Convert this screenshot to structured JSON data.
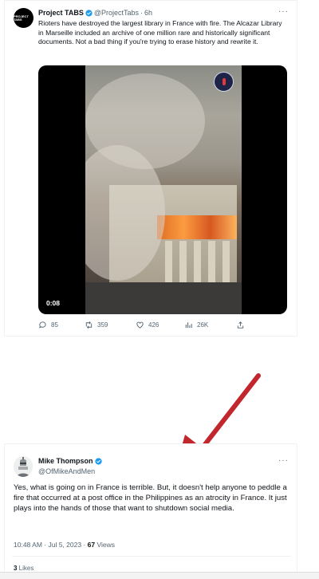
{
  "tweet1": {
    "avatar_text": "PROJECT TABS",
    "name": "Project TABS",
    "handle": "@ProjectTabs",
    "separator": "·",
    "time": "6h",
    "more": "···",
    "text": "Rioters have destroyed the largest library in France with fire. The Alcazar Library in Marseille included an archive of one million rare and historically significant documents. Not a bad thing if you're trying to erase history and rewrite it.",
    "video_duration": "0:08",
    "actions": {
      "replies": "85",
      "retweets": "359",
      "likes": "426",
      "views": "26K"
    }
  },
  "tweet2": {
    "name": "Mike Thompson",
    "handle": "@OfMikeAndMen",
    "more": "···",
    "text": "Yes, what is going on in France is terrible. But, it doesn't help anyone to peddle a fire that occurred at a post office in the Philippines as an atrocity in France. It just plays into the hands of those that want to shutdown social media.",
    "timestamp": "10:48 AM · Jul 5, 2023 · ",
    "views_count": "67",
    "views_label": " Views",
    "likes_count": "3",
    "likes_label": " Likes"
  },
  "colors": {
    "verified": "#1d9bf0",
    "arrow": "#c1272d",
    "muted": "#536471"
  }
}
